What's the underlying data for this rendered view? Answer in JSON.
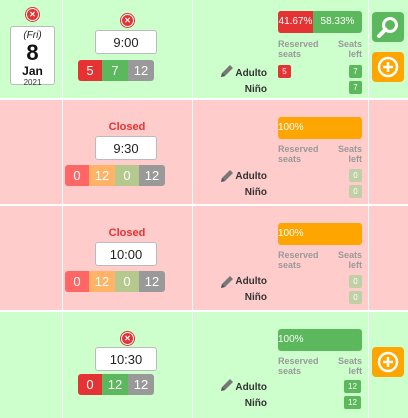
{
  "date": {
    "weekday": "(Fri)",
    "day": "8",
    "month": "Jan",
    "year": "2021"
  },
  "labels": {
    "reserved": "Reserved seats",
    "reserved_l1": "Reserved",
    "reserved_l2": "seats",
    "left_l1": "Seats",
    "left_l2": "left"
  },
  "colors": {
    "green": "#5cb85c",
    "red": "#e53333",
    "orange": "#ffa500",
    "gray": "#999999",
    "row_green": "#ccffcc",
    "row_red": "#ffcccc"
  },
  "slots": [
    {
      "time": "9:00",
      "status": "",
      "counters": [
        "5",
        "7",
        "12"
      ],
      "categories": [
        {
          "name": "Adulto",
          "reserved": "5",
          "left": "7"
        },
        {
          "name": "Niño",
          "reserved": "",
          "left": "7"
        }
      ],
      "reserved_pct": 0.4167,
      "reserved_label": "41.67%",
      "left_label": "58.33%"
    },
    {
      "time": "9:30",
      "status": "Closed",
      "counters": [
        "0",
        "12",
        "0",
        "12"
      ],
      "categories": [
        {
          "name": "Adulto",
          "reserved": "",
          "left": "0"
        },
        {
          "name": "Niño",
          "reserved": "",
          "left": "0"
        }
      ],
      "bar_label": "100%"
    },
    {
      "time": "10:00",
      "status": "Closed",
      "counters": [
        "0",
        "12",
        "0",
        "12"
      ],
      "categories": [
        {
          "name": "Adulto",
          "reserved": "",
          "left": "0"
        },
        {
          "name": "Niño",
          "reserved": "",
          "left": "0"
        }
      ],
      "bar_label": "100%"
    },
    {
      "time": "10:30",
      "status": "",
      "counters": [
        "0",
        "12",
        "12"
      ],
      "categories": [
        {
          "name": "Adulto",
          "reserved": "",
          "left": "12"
        },
        {
          "name": "Niño",
          "reserved": "",
          "left": "12"
        }
      ],
      "bar_label": "100%"
    }
  ],
  "actions": {
    "search": "search-icon",
    "add": "plus-icon"
  }
}
